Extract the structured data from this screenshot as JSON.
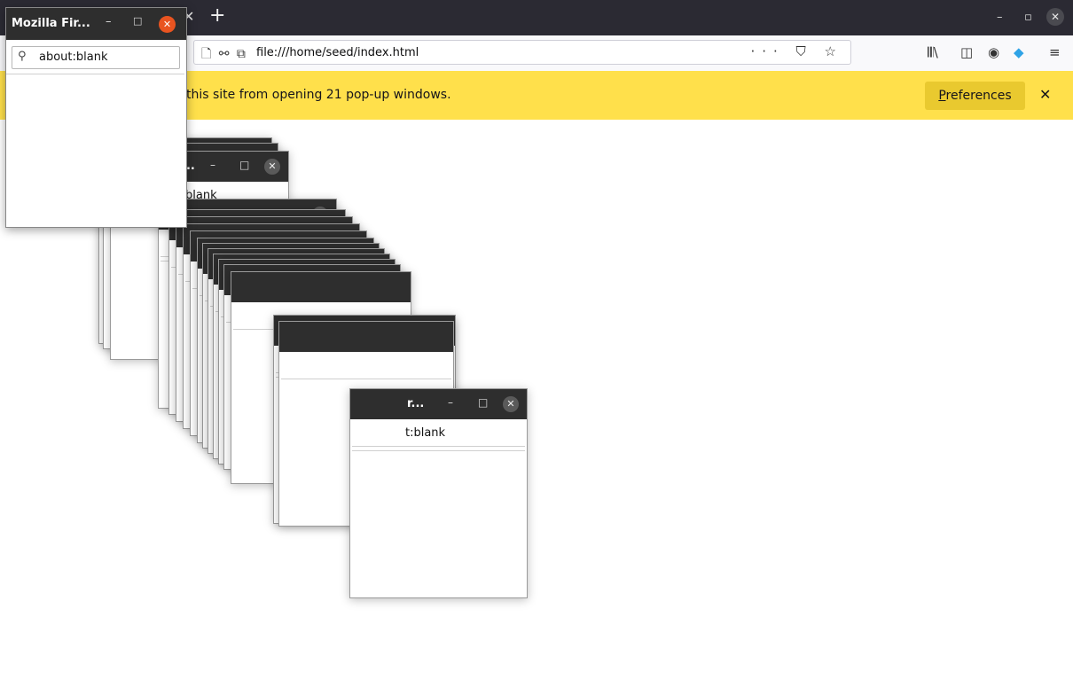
{
  "browser": {
    "tab_close": "✕",
    "new_tab": "+",
    "url": "file:///home/seed/index.html",
    "url_icons": "🗋 ⚯ ⧉",
    "url_actions": "··· ⛉ ☆",
    "toolbar_library": "𝄃𝄃\\",
    "toolbar_sidebar": "◫",
    "toolbar_account": "◉",
    "toolbar_ext": "◆",
    "toolbar_menu": "≡",
    "win_min": "–",
    "win_restore": "▫",
    "win_close": "✕"
  },
  "notification": {
    "message": "this site from opening 21 pop-up windows.",
    "preferences_prefix": "P",
    "preferences_rest": "references",
    "close": "✕"
  },
  "front_popup": {
    "title": "Mozilla Fir...",
    "minimize": "–",
    "maximize": "□",
    "close": "✕",
    "url": "about:blank",
    "search_icon": "⚲"
  },
  "popups": {
    "a_title": "...",
    "a_url": "blank",
    "b_title": "r...",
    "b_url": "t:blank",
    "min": "–",
    "max": "□",
    "close": "✕"
  },
  "colors": {
    "notification": "#ffe04b",
    "tabbar": "#2b2a33",
    "close_accent": "#e95420"
  }
}
